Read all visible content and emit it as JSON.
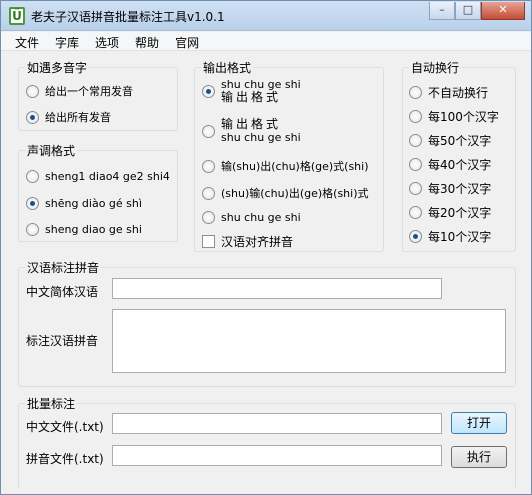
{
  "window": {
    "title": "老夫子汉语拼音批量标注工具v1.0.1",
    "icon_glyph": "Ü",
    "buttons": {
      "minimize": "–",
      "maximize": "□",
      "close": "✕"
    }
  },
  "menu": [
    "文件",
    "字库",
    "选项",
    "帮助",
    "官网"
  ],
  "polyphone": {
    "title": "如遇多音字",
    "options": [
      "给出一个常用发音",
      "给出所有发音"
    ],
    "selected": 1
  },
  "tone": {
    "title": "声调格式",
    "options": [
      "sheng1 diao4 ge2 shi4",
      "shēng diào gé shì",
      "sheng diao ge shi"
    ],
    "selected": 1
  },
  "output": {
    "title": "输出格式",
    "opt1": {
      "pinyin": "shu chu ge shi",
      "hanzi": "输出格式"
    },
    "opt2": {
      "hanzi": "输出格式",
      "pinyin": "shu chu ge shi"
    },
    "opt3": "输(shu)出(chu)格(ge)式(shi)",
    "opt4": "(shu)输(chu)出(ge)格(shi)式",
    "opt5": "shu chu ge shi",
    "selected": 0,
    "align_checkbox": "汉语对齐拼音",
    "align_checked": false
  },
  "autowrap": {
    "title": "自动换行",
    "options": [
      "不自动换行",
      "每100个汉字",
      "每50个汉字",
      "每40个汉字",
      "每30个汉字",
      "每20个汉字",
      "每10个汉字"
    ],
    "selected": 6
  },
  "annotate": {
    "title": "汉语标注拼音",
    "chinese_label": "中文简体汉语",
    "chinese_value": "",
    "pinyin_label": "标注汉语拼音",
    "pinyin_value": ""
  },
  "batch": {
    "title": "批量标注",
    "cn_file_label": "中文文件(.txt)",
    "cn_file_value": "",
    "open_button": "打开",
    "py_file_label": "拼音文件(.txt)",
    "py_file_value": "",
    "run_button": "执行"
  }
}
